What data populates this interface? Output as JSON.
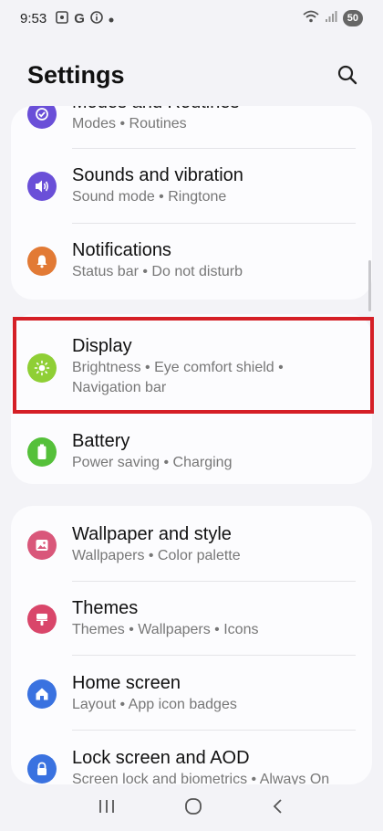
{
  "status_bar": {
    "time": "9:53",
    "g_label": "G",
    "battery": "50"
  },
  "header": {
    "title": "Settings"
  },
  "group1": [
    {
      "title": "Modes and Routines",
      "sub": "Modes  •  Routines",
      "icon": "modes-routines-icon",
      "color": "#6a4fd8"
    },
    {
      "title": "Sounds and vibration",
      "sub": "Sound mode  •  Ringtone",
      "icon": "sound-icon",
      "color": "#6a4fd8"
    },
    {
      "title": "Notifications",
      "sub": "Status bar  •  Do not disturb",
      "icon": "bell-icon",
      "color": "#e27a35"
    }
  ],
  "group2": [
    {
      "title": "Display",
      "sub": "Brightness  •  Eye comfort shield  •",
      "sub2": "Navigation bar",
      "icon": "sun-icon",
      "color": "#8fcf35"
    },
    {
      "title": "Battery",
      "sub": "Power saving  •  Charging",
      "icon": "battery-icon",
      "color": "#55c03a"
    }
  ],
  "group3": [
    {
      "title": "Wallpaper and style",
      "sub": "Wallpapers  •  Color palette",
      "icon": "wallpaper-icon",
      "color": "#d9577a"
    },
    {
      "title": "Themes",
      "sub": "Themes  •  Wallpapers  •  Icons",
      "icon": "themes-icon",
      "color": "#d9466a"
    },
    {
      "title": "Home screen",
      "sub": "Layout  •  App icon badges",
      "icon": "home-icon",
      "color": "#3a72e0"
    },
    {
      "title": "Lock screen and AOD",
      "sub": "Screen lock and biometrics  •  Always On",
      "icon": "lock-icon",
      "color": "#3a72e0"
    }
  ]
}
